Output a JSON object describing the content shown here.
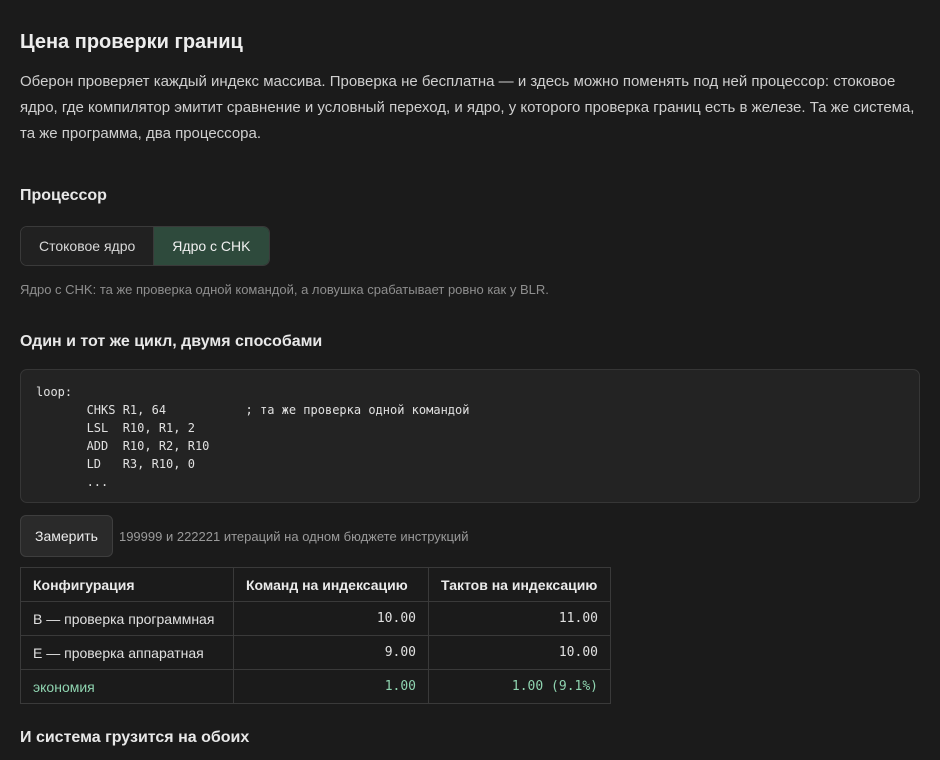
{
  "title": "Цена проверки границ",
  "intro": "Оберон проверяет каждый индекс массива. Проверка не бесплатна — и здесь можно поменять под ней процессор: стоковое ядро, где компилятор эмитит сравнение и условный переход, и ядро, у которого проверка границ есть в железе. Та же система, та же программа, два процессора.",
  "processor": {
    "heading": "Процессор",
    "options": [
      "Стоковое ядро",
      "Ядро с CHK"
    ],
    "selected": "Ядро с CHK",
    "note": "Ядро с CHK: та же проверка одной командой, а ловушка срабатывает ровно как у BLR."
  },
  "loop": {
    "heading": "Один и тот же цикл, двумя способами",
    "code_lines": [
      "loop:",
      "       CHKS R1, 64           ; та же проверка одной командой",
      "       LSL  R10, R1, 2",
      "       ADD  R10, R2, R10",
      "       LD   R3, R10, 0",
      "       ..."
    ]
  },
  "measure": {
    "button_label": "Замерить",
    "note": "199999 и 222221 итераций на одном бюджете инструкций"
  },
  "table": {
    "headers": [
      "Конфигурация",
      "Команд на индексацию",
      "Тактов на индексацию"
    ],
    "rows": [
      [
        "B — проверка программная",
        "10.00",
        "11.00"
      ],
      [
        "E — проверка аппаратная",
        "9.00",
        "10.00"
      ]
    ],
    "saving": [
      "экономия",
      "1.00",
      "1.00 (9.1%)"
    ]
  },
  "boot_heading": "И система грузится на обоих",
  "colors": {
    "background": "#1b1b1b",
    "active_segment": "#2e4a3c",
    "saving_text": "#8fd4b0"
  }
}
